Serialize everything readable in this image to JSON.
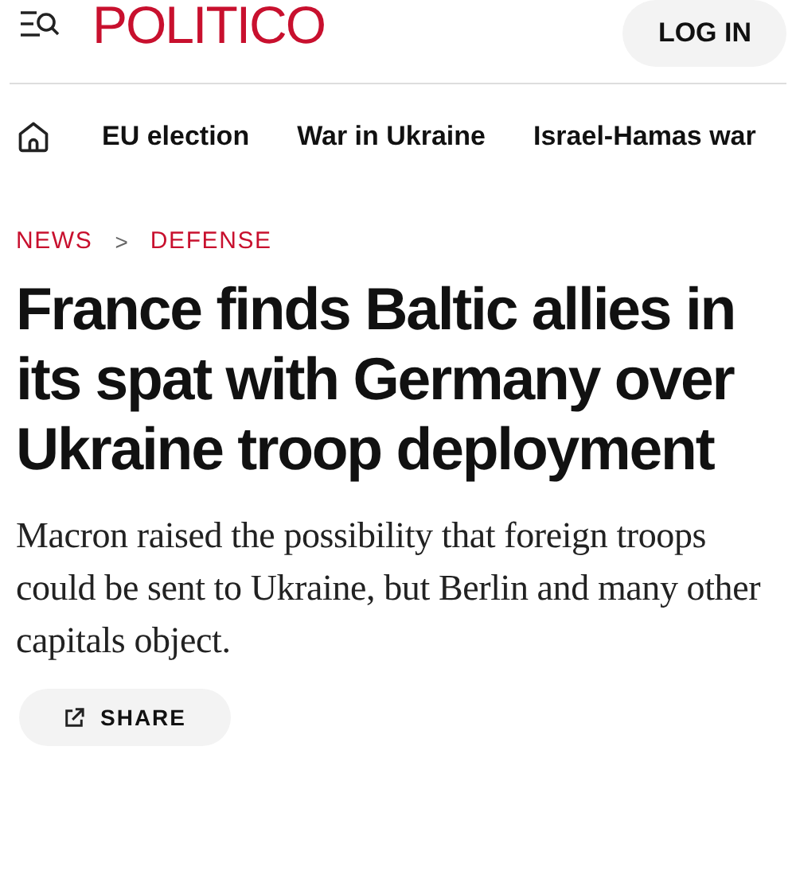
{
  "header": {
    "logo": "POLITICO",
    "login_button": "LOG IN"
  },
  "nav": {
    "items": [
      "EU election",
      "War in Ukraine",
      "Israel-Hamas war"
    ]
  },
  "breadcrumb": [
    "NEWS",
    "DEFENSE"
  ],
  "breadcrumb_separator": ">",
  "headline": "France finds Baltic allies in its spat with Germany over Ukraine troop deployment",
  "deck": "Macron raised the possibility that foreign troops could be sent to Ukraine, but Berlin and many other capitals object.",
  "share_button": "SHARE"
}
